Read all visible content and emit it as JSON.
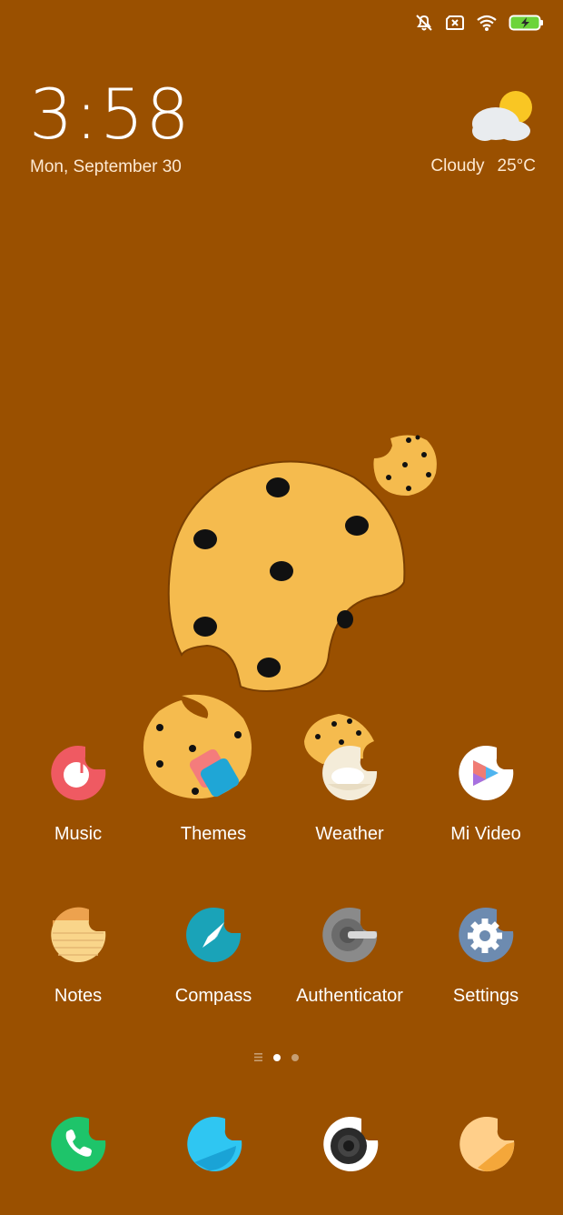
{
  "status_bar": {
    "icons": [
      "muted-notifications-icon",
      "no-sim-icon",
      "wifi-icon",
      "battery-charging-icon"
    ],
    "battery_color": "#6cd43a"
  },
  "clock": {
    "time": "3:58",
    "date": "Mon, September 30"
  },
  "weather": {
    "icon": "partly-cloudy-icon",
    "condition": "Cloudy",
    "temperature": "25°C"
  },
  "apps": [
    {
      "label": "Music",
      "icon": "music-icon"
    },
    {
      "label": "Themes",
      "icon": "themes-icon"
    },
    {
      "label": "Weather",
      "icon": "weather-icon"
    },
    {
      "label": "Mi Video",
      "icon": "mi-video-icon"
    },
    {
      "label": "Notes",
      "icon": "notes-icon"
    },
    {
      "label": "Compass",
      "icon": "compass-icon"
    },
    {
      "label": "Authenticator",
      "icon": "authenticator-icon"
    },
    {
      "label": "Settings",
      "icon": "settings-icon"
    }
  ],
  "pager": {
    "pages": 2,
    "active_page": 1
  },
  "dock": [
    {
      "icon": "phone-icon"
    },
    {
      "icon": "messages-icon"
    },
    {
      "icon": "camera-icon"
    },
    {
      "icon": "browser-icon"
    }
  ],
  "colors": {
    "wallpaper": "#9a5000",
    "cookie": "#f5bb4e",
    "chocolate_chip": "#000000"
  }
}
